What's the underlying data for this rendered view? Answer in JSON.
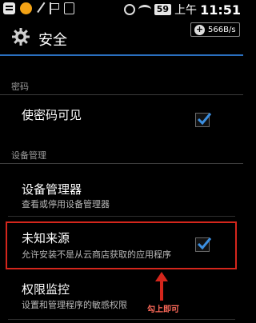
{
  "status_bar": {
    "battery": "59",
    "ampm": "上午",
    "time": "11:51"
  },
  "title_bar": {
    "title": "安全",
    "speed": "566B/s",
    "speed_plus": "+"
  },
  "sections": {
    "password_header": "密码",
    "device_admin_header": "设备管理"
  },
  "items": {
    "show_password": {
      "title": "使密码可见",
      "checked": true
    },
    "device_admins": {
      "title": "设备管理器",
      "subtitle": "查看或停用设备管理器"
    },
    "unknown_sources": {
      "title": "未知来源",
      "subtitle": "允许安装不是从云商店获取的应用程序",
      "checked": true
    },
    "permission_monitor": {
      "title": "权限监控",
      "subtitle": "设置和管理程序的敏感权限"
    }
  },
  "annotation": {
    "text": "勾上即可",
    "color": "#d4261c"
  },
  "colors": {
    "accent": "#2a6fbf",
    "check": "#3c8fe0"
  }
}
